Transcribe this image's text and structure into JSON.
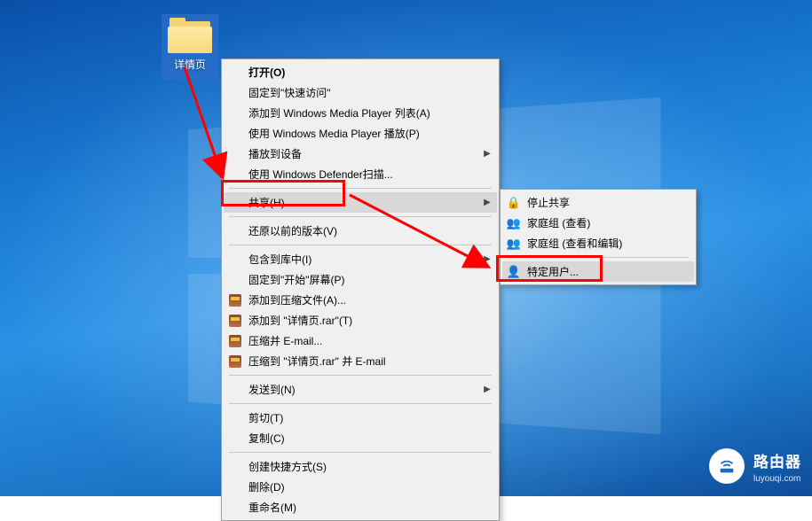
{
  "desktop": {
    "folder_label": "详情页"
  },
  "context_menu": {
    "items": [
      {
        "label": "打开(O)",
        "bold": true
      },
      {
        "label": "固定到\"快速访问\""
      },
      {
        "label": "添加到 Windows Media Player 列表(A)"
      },
      {
        "label": "使用 Windows Media Player 播放(P)"
      },
      {
        "label": "播放到设备",
        "submenu": true
      },
      {
        "label": "使用 Windows Defender扫描..."
      },
      {
        "sep": true
      },
      {
        "label": "共享(H)",
        "submenu": true,
        "highlighted": true
      },
      {
        "sep": true
      },
      {
        "label": "还原以前的版本(V)"
      },
      {
        "sep": true
      },
      {
        "label": "包含到库中(I)",
        "submenu": true
      },
      {
        "label": "固定到\"开始\"屏幕(P)"
      },
      {
        "label": "添加到压缩文件(A)...",
        "icon": "rar"
      },
      {
        "label": "添加到 \"详情页.rar\"(T)",
        "icon": "rar"
      },
      {
        "label": "压缩并 E-mail...",
        "icon": "rar"
      },
      {
        "label": "压缩到 \"详情页.rar\" 并 E-mail",
        "icon": "rar"
      },
      {
        "sep": true
      },
      {
        "label": "发送到(N)",
        "submenu": true
      },
      {
        "sep": true
      },
      {
        "label": "剪切(T)"
      },
      {
        "label": "复制(C)"
      },
      {
        "sep": true
      },
      {
        "label": "创建快捷方式(S)"
      },
      {
        "label": "删除(D)"
      },
      {
        "label": "重命名(M)"
      }
    ]
  },
  "share_submenu": {
    "items": [
      {
        "label": "停止共享",
        "icon": "lock"
      },
      {
        "label": "家庭组 (查看)",
        "icon": "group"
      },
      {
        "label": "家庭组 (查看和编辑)",
        "icon": "group"
      },
      {
        "sep": true
      },
      {
        "label": "特定用户...",
        "icon": "user",
        "highlighted": true
      }
    ]
  },
  "watermark": {
    "name": "路由器",
    "url": "luyouqi.com"
  }
}
